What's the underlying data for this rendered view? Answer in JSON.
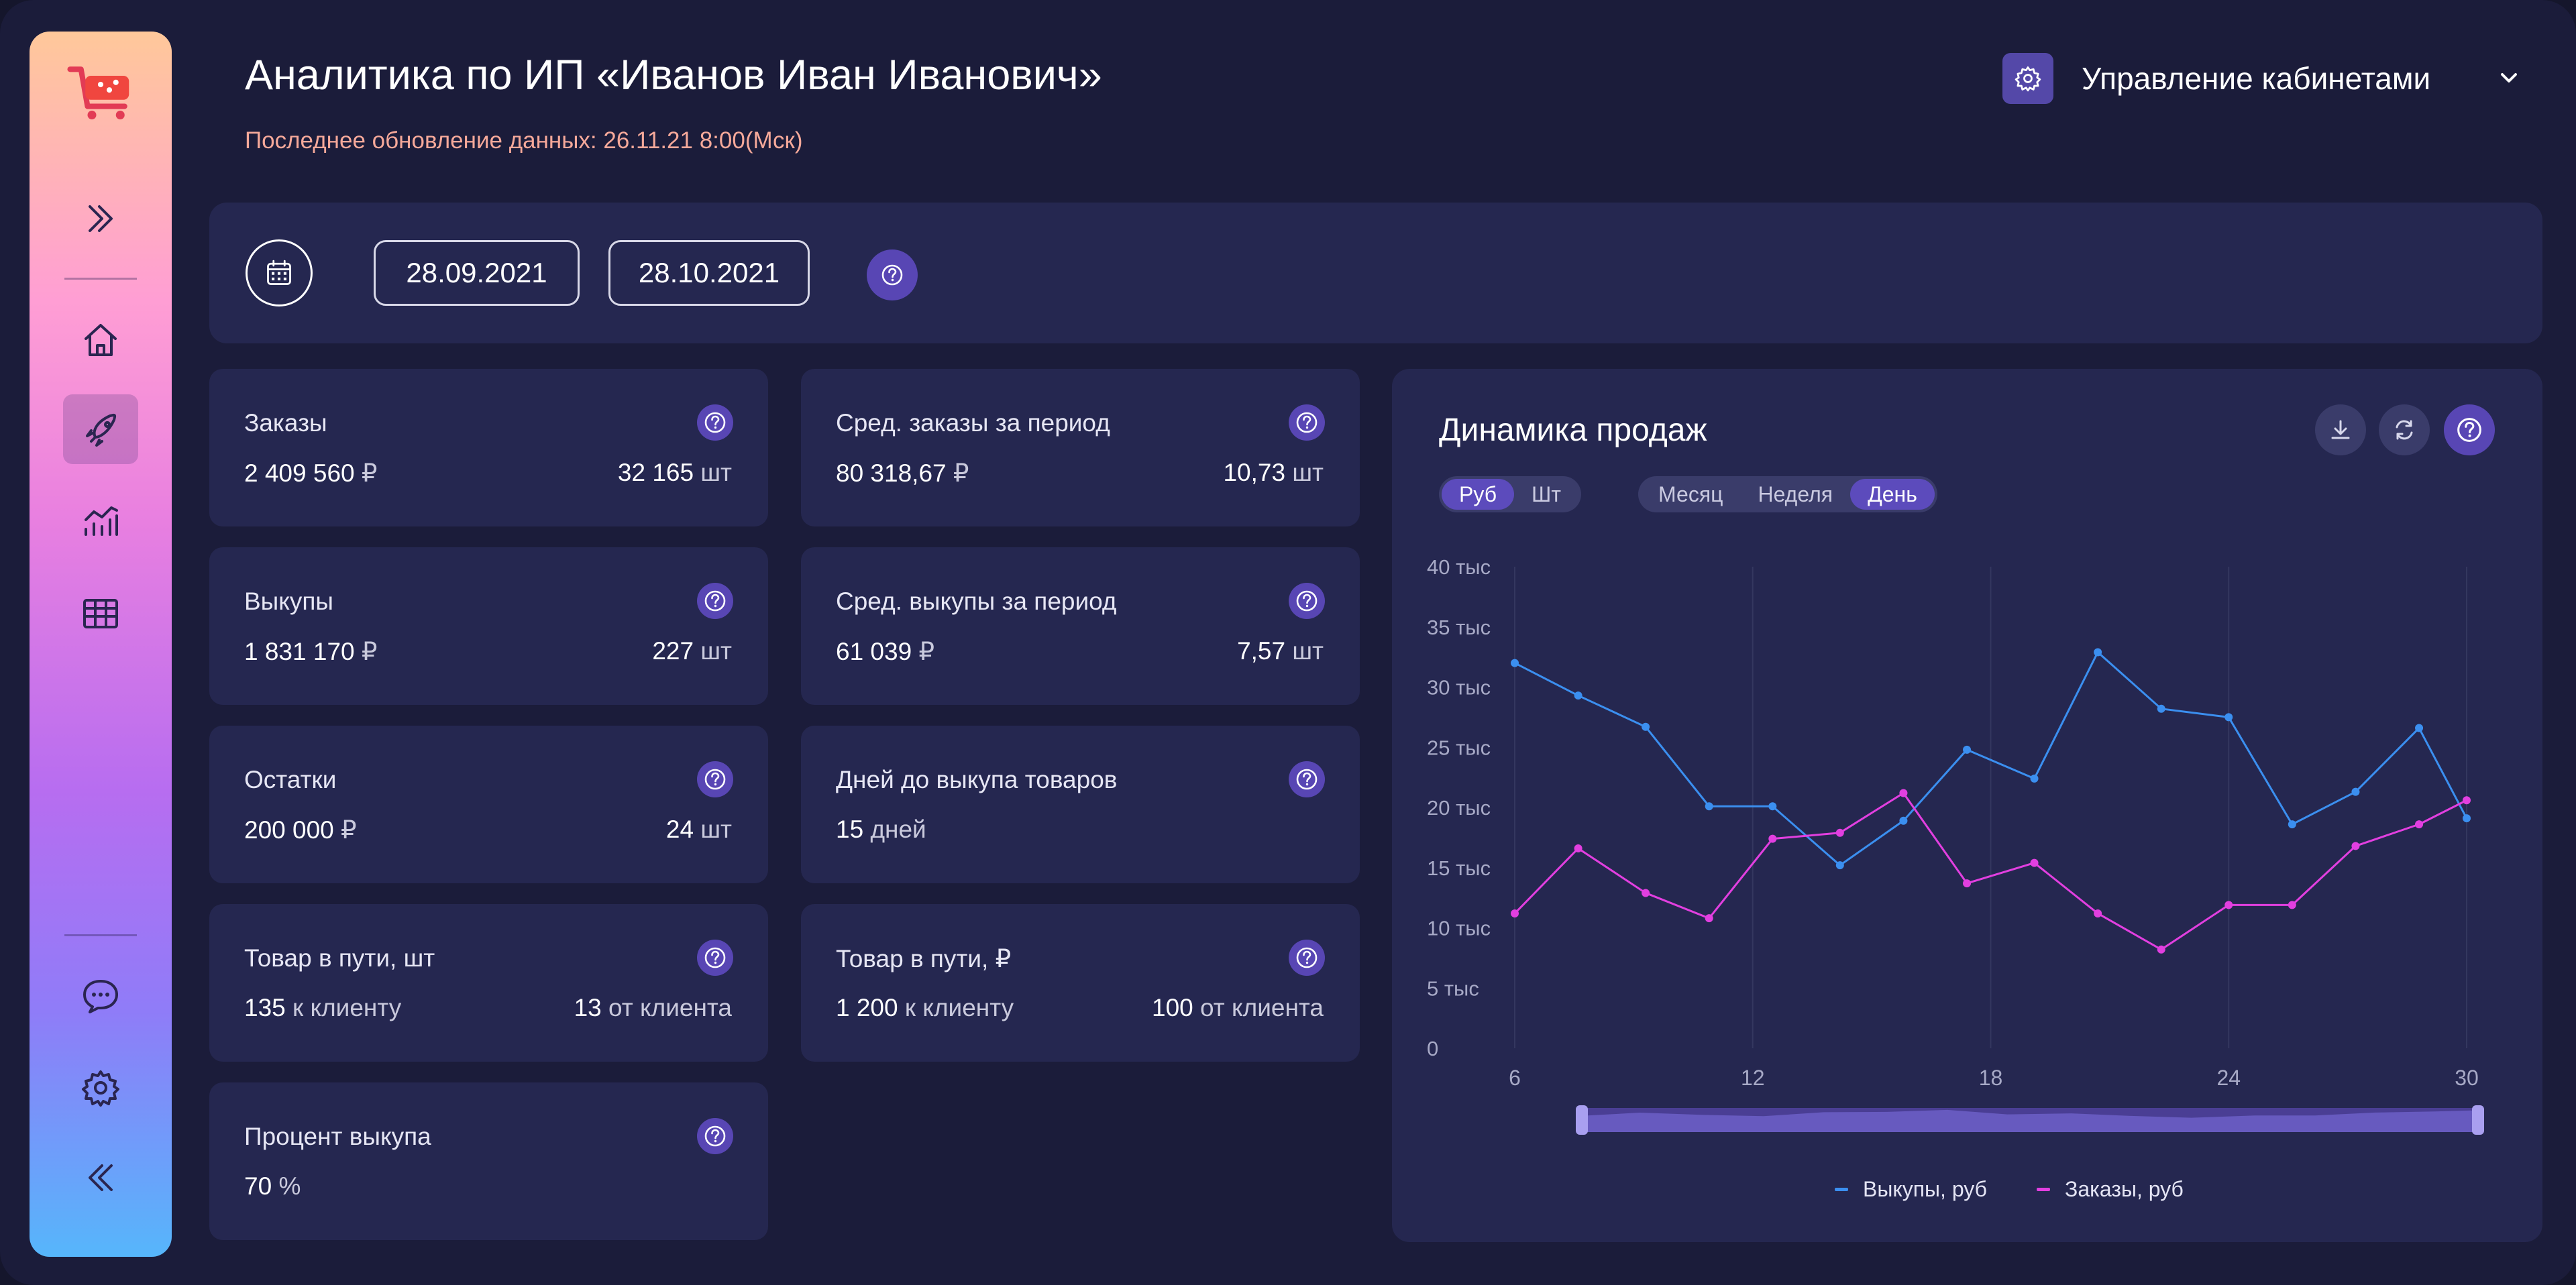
{
  "header": {
    "title": "Аналитика по ИП «Иванов Иван Иванович»",
    "last_update": "Последнее обновление данных: 26.11.21 8:00(Мск)",
    "cabinet_label": "Управление кабинетами"
  },
  "sidebar": {
    "items": [
      {
        "icon": "cart-logo-icon"
      },
      {
        "icon": "expand-icon"
      },
      {
        "icon": "home-icon"
      },
      {
        "icon": "rocket-icon"
      },
      {
        "icon": "analytics-icon"
      },
      {
        "icon": "table-icon"
      },
      {
        "icon": "chat-icon"
      },
      {
        "icon": "settings-icon"
      },
      {
        "icon": "collapse-icon"
      }
    ]
  },
  "dates": {
    "from": "28.09.2021",
    "to": "28.10.2021"
  },
  "cards": [
    {
      "label": "Заказы",
      "left": "2 409 560",
      "left_unit": "₽",
      "right": "32 165",
      "right_unit": "шт"
    },
    {
      "label": "Сред. заказы за период",
      "left": "80 318,67",
      "left_unit": "₽",
      "right": "10,73",
      "right_unit": "шт"
    },
    {
      "label": "Выкупы",
      "left": "1 831 170",
      "left_unit": "₽",
      "right": "227",
      "right_unit": "шт"
    },
    {
      "label": "Сред. выкупы за период",
      "left": "61 039",
      "left_unit": "₽",
      "right": "7,57",
      "right_unit": "шт"
    },
    {
      "label": "Остатки",
      "left": "200 000",
      "left_unit": "₽",
      "right": "24",
      "right_unit": "шт"
    },
    {
      "label": "Дней до выкупа товаров",
      "left": "15",
      "left_unit": "дней",
      "right": "",
      "right_unit": ""
    },
    {
      "label": "Товар в пути, шт",
      "left": "135",
      "left_unit": "к клиенту",
      "right": "13",
      "right_unit": "от клиента"
    },
    {
      "label": "Товар в пути, ₽",
      "left": "1 200",
      "left_unit": "к клиенту",
      "right": "100",
      "right_unit": "от клиента"
    },
    {
      "label": "Процент выкупа",
      "left": "70",
      "left_unit": "%",
      "right": "",
      "right_unit": ""
    }
  ],
  "chart_panel": {
    "title": "Динамика продаж",
    "currency_toggle": [
      "Руб",
      "Шт"
    ],
    "currency_selected": "Руб",
    "period_toggle": [
      "Месяц",
      "Неделя",
      "День"
    ],
    "period_selected": "День"
  },
  "colors": {
    "buyouts": "#3b8ff0",
    "orders": "#e23fe0",
    "accent": "#5846b4"
  },
  "chart_data": {
    "type": "line",
    "x": [
      6,
      8,
      10,
      11,
      12,
      13,
      14,
      15,
      16,
      17,
      18,
      19,
      20,
      21,
      22,
      23,
      24,
      25,
      26,
      27,
      28,
      29,
      30
    ],
    "y_ticks": [
      "0",
      "5 тыс",
      "10 тыс",
      "15 тыс",
      "20 тыс",
      "25 тыс",
      "30 тыс",
      "35 тыс",
      "40 тыс"
    ],
    "x_ticks": [
      "6",
      "12",
      "18",
      "24",
      "30"
    ],
    "ylim": [
      0,
      40000
    ],
    "xlim": [
      6,
      30
    ],
    "grid": "vertical",
    "legend_position": "bottom-center",
    "series": [
      {
        "name": "Выкупы, руб",
        "points": [
          [
            6,
            32000
          ],
          [
            7.6,
            29300
          ],
          [
            9.3,
            26700
          ],
          [
            10.9,
            20100
          ],
          [
            12.5,
            20100
          ],
          [
            14.2,
            15200
          ],
          [
            15.8,
            18900
          ],
          [
            17.4,
            24800
          ],
          [
            19.1,
            22400
          ],
          [
            20.7,
            32900
          ],
          [
            22.3,
            28200
          ],
          [
            24,
            27500
          ],
          [
            25.6,
            18600
          ],
          [
            27.2,
            21300
          ],
          [
            28.8,
            26600
          ],
          [
            30,
            19100
          ]
        ]
      },
      {
        "name": "Заказы, руб",
        "points": [
          [
            6,
            11200
          ],
          [
            7.6,
            16600
          ],
          [
            9.3,
            12900
          ],
          [
            10.9,
            10800
          ],
          [
            12.5,
            17400
          ],
          [
            14.2,
            17900
          ],
          [
            15.8,
            21200
          ],
          [
            17.4,
            13700
          ],
          [
            19.1,
            15400
          ],
          [
            20.7,
            11200
          ],
          [
            22.3,
            8200
          ],
          [
            24,
            11900
          ],
          [
            25.6,
            11900
          ],
          [
            27.2,
            16800
          ],
          [
            28.8,
            18600
          ],
          [
            30,
            20600
          ]
        ]
      }
    ]
  }
}
